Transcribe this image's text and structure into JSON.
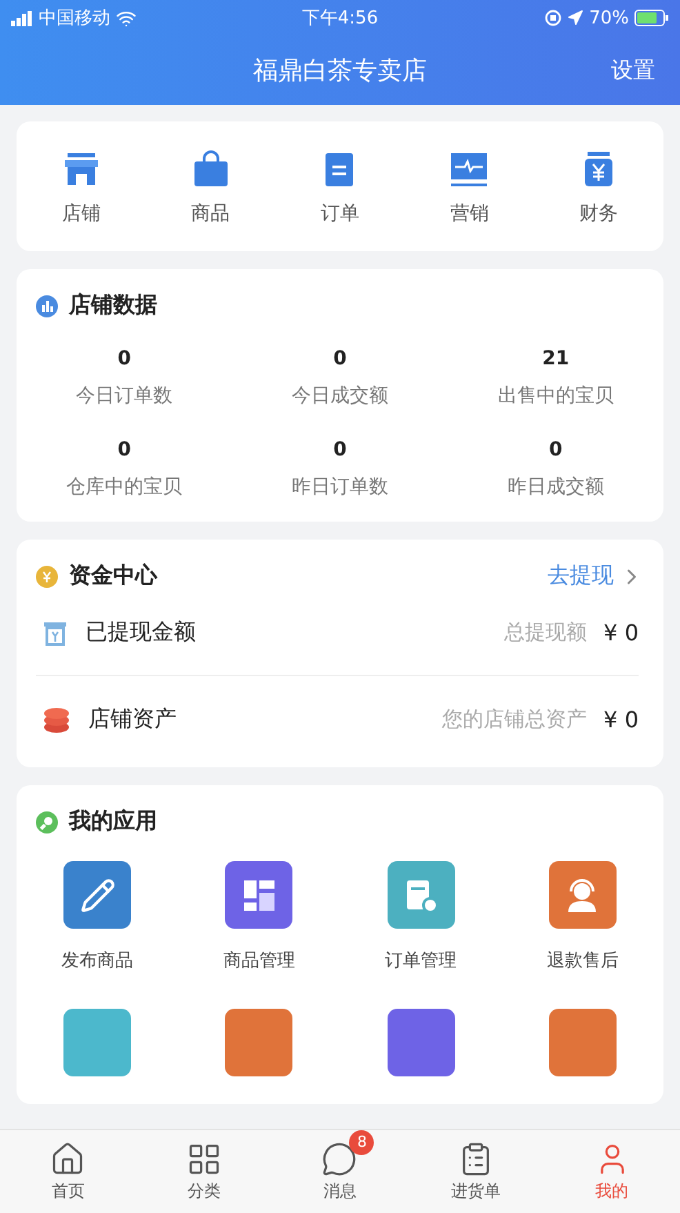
{
  "status_bar": {
    "carrier": "中国移动",
    "time": "下午4:56",
    "battery": "70%"
  },
  "header": {
    "title": "福鼎白茶专卖店",
    "action": "设置"
  },
  "shortcuts": [
    {
      "label": "店铺",
      "kind": "store"
    },
    {
      "label": "商品",
      "kind": "bag"
    },
    {
      "label": "订单",
      "kind": "doc"
    },
    {
      "label": "营销",
      "kind": "pulse"
    },
    {
      "label": "财务",
      "kind": "yuan"
    }
  ],
  "shop_data": {
    "title": "店铺数据",
    "stats": [
      {
        "value": "0",
        "label": "今日订单数"
      },
      {
        "value": "0",
        "label": "今日成交额"
      },
      {
        "value": "21",
        "label": "出售中的宝贝"
      },
      {
        "value": "0",
        "label": "仓库中的宝贝"
      },
      {
        "value": "0",
        "label": "昨日订单数"
      },
      {
        "value": "0",
        "label": "昨日成交额"
      }
    ]
  },
  "funds": {
    "title": "资金中心",
    "link": "去提现",
    "rows": [
      {
        "kind": "withdrawn",
        "label": "已提现金额",
        "hint": "总提现额",
        "amount": "¥ 0"
      },
      {
        "kind": "assets",
        "label": "店铺资产",
        "hint": "您的店铺总资产",
        "amount": "¥ 0"
      }
    ]
  },
  "apps": {
    "title": "我的应用",
    "items": [
      {
        "kind": "edit",
        "label": "发布商品",
        "color": "#3a82cc"
      },
      {
        "kind": "layout",
        "label": "商品管理",
        "color": "#6e63e6"
      },
      {
        "kind": "form",
        "label": "订单管理",
        "color": "#4cb0c0"
      },
      {
        "kind": "service",
        "label": "退款售后",
        "color": "#e0733a"
      },
      {
        "kind": "tile",
        "color": "#4cb8cc"
      },
      {
        "kind": "tile",
        "color": "#e0733a"
      },
      {
        "kind": "tile",
        "color": "#6e63e6"
      },
      {
        "kind": "tile",
        "color": "#e0733a"
      }
    ]
  },
  "tab_bar": [
    {
      "label": "首页",
      "kind": "home",
      "selected": false
    },
    {
      "label": "分类",
      "kind": "grid",
      "selected": false
    },
    {
      "label": "消息",
      "kind": "chat",
      "selected": false,
      "badge": "8"
    },
    {
      "label": "进货单",
      "kind": "list",
      "selected": false
    },
    {
      "label": "我的",
      "kind": "user",
      "selected": true
    }
  ]
}
